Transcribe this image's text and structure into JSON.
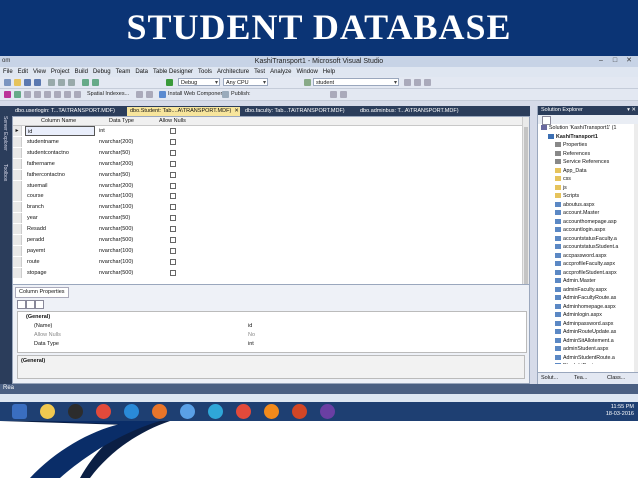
{
  "slide": {
    "title": "STUDENT DATABASE"
  },
  "window": {
    "title": "KashiTransport1 - Microsoft Visual Studio",
    "left_text": "om",
    "menu": [
      "File",
      "Edit",
      "View",
      "Project",
      "Build",
      "Debug",
      "Team",
      "Data",
      "Table Designer",
      "Tools",
      "Architecture",
      "Test",
      "Analyze",
      "Window",
      "Help"
    ]
  },
  "toolbar": {
    "config": "Debug",
    "platform": "Any CPU",
    "find": "student",
    "spatial": "Spatial Indexes...",
    "install": "Install Web Components",
    "publish": "Publish:"
  },
  "tabs": [
    {
      "label": "dbo.userlogin: T...TA\\TRANSPORT.MDF)",
      "active": false
    },
    {
      "label": "dbo.Student: Tab....A\\TRANSPORT.MDF)",
      "active": true,
      "close": "✕"
    },
    {
      "label": "dbo.faculty: Tab...TA\\TRANSPORT.MDF)",
      "active": false
    },
    {
      "label": "dbo.adminbus: T...A\\TRANSPORT.MDF)",
      "active": false
    }
  ],
  "left_tools": {
    "server": "Server Explorer",
    "toolbox": "Toolbox"
  },
  "table_designer": {
    "headers": {
      "column_name": "Column Name",
      "data_type": "Data Type",
      "allow_nulls": "Allow Nulls"
    },
    "rows": [
      {
        "name": "id",
        "type": "int"
      },
      {
        "name": "studentname",
        "type": "nvarchar(200)"
      },
      {
        "name": "studentcontactno",
        "type": "nvarchar(50)"
      },
      {
        "name": "fathername",
        "type": "nvarchar(200)"
      },
      {
        "name": "fathercontactno",
        "type": "nvarchar(50)"
      },
      {
        "name": "stuemail",
        "type": "nvarchar(200)"
      },
      {
        "name": "course",
        "type": "nvarchar(100)"
      },
      {
        "name": "branch",
        "type": "nvarchar(100)"
      },
      {
        "name": "year",
        "type": "nvarchar(50)"
      },
      {
        "name": "Resadd",
        "type": "nvarchar(500)"
      },
      {
        "name": "peradd",
        "type": "nvarchar(500)"
      },
      {
        "name": "payemt",
        "type": "nvarchar(100)"
      },
      {
        "name": "route",
        "type": "nvarchar(100)"
      },
      {
        "name": "stopage",
        "type": "nvarchar(500)"
      }
    ]
  },
  "column_properties": {
    "tab": "Column Properties",
    "rows": [
      {
        "key": "(General)",
        "value": "",
        "style": "bold"
      },
      {
        "key": "(Name)",
        "value": "id",
        "style": ""
      },
      {
        "key": "Allow Nulls",
        "value": "No",
        "style": "dim"
      },
      {
        "key": "Data Type",
        "value": "int",
        "style": ""
      }
    ],
    "description": "(General)"
  },
  "solution_explorer": {
    "title": "Solution Explorer",
    "pin": "▾ ✕",
    "items": [
      {
        "label": "Solution 'KashiTransport1' (1",
        "indent": 0,
        "icon": "#6a6aa0"
      },
      {
        "label": "KashiTransport1",
        "indent": 1,
        "icon": "#3b6fb3",
        "bold": true
      },
      {
        "label": "Properties",
        "indent": 2,
        "icon": "#888"
      },
      {
        "label": "References",
        "indent": 2,
        "icon": "#888"
      },
      {
        "label": "Service References",
        "indent": 2,
        "icon": "#888"
      },
      {
        "label": "App_Data",
        "indent": 2,
        "icon": "#e6c35c"
      },
      {
        "label": "css",
        "indent": 2,
        "icon": "#e6c35c"
      },
      {
        "label": "js",
        "indent": 2,
        "icon": "#e6c35c"
      },
      {
        "label": "Scripts",
        "indent": 2,
        "icon": "#e6c35c"
      },
      {
        "label": "aboutus.aspx",
        "indent": 2,
        "icon": "#5b88c4"
      },
      {
        "label": "account.Master",
        "indent": 2,
        "icon": "#5b88c4"
      },
      {
        "label": "accounthomepage.asp",
        "indent": 2,
        "icon": "#5b88c4"
      },
      {
        "label": "accountlogin.aspx",
        "indent": 2,
        "icon": "#5b88c4"
      },
      {
        "label": "accountstatusFaculty.a",
        "indent": 2,
        "icon": "#5b88c4"
      },
      {
        "label": "accountstatusStudent.a",
        "indent": 2,
        "icon": "#5b88c4"
      },
      {
        "label": "accpassword.aspx",
        "indent": 2,
        "icon": "#5b88c4"
      },
      {
        "label": "accprofileFaculty.aspx",
        "indent": 2,
        "icon": "#5b88c4"
      },
      {
        "label": "accprofileStudent.aspx",
        "indent": 2,
        "icon": "#5b88c4"
      },
      {
        "label": "Admin.Master",
        "indent": 2,
        "icon": "#5b88c4"
      },
      {
        "label": "adminFaculty.aspx",
        "indent": 2,
        "icon": "#5b88c4"
      },
      {
        "label": "AdminFacultyRoute.as",
        "indent": 2,
        "icon": "#5b88c4"
      },
      {
        "label": "Adminhomepage.aspx",
        "indent": 2,
        "icon": "#5b88c4"
      },
      {
        "label": "Adminlogin.aspx",
        "indent": 2,
        "icon": "#5b88c4"
      },
      {
        "label": "Adminpassword.aspx",
        "indent": 2,
        "icon": "#5b88c4"
      },
      {
        "label": "AdminRouteUpdate.as",
        "indent": 2,
        "icon": "#5b88c4"
      },
      {
        "label": "AdminSitAllotement.a",
        "indent": 2,
        "icon": "#5b88c4"
      },
      {
        "label": "adminStudent.aspx",
        "indent": 2,
        "icon": "#5b88c4"
      },
      {
        "label": "AdminStudentRoute.a",
        "indent": 2,
        "icon": "#5b88c4"
      },
      {
        "label": "BhadohiRoute.aspx",
        "indent": 2,
        "icon": "#5b88c4"
      }
    ],
    "tabs": [
      "Solut...",
      "Tea...",
      "Class..."
    ]
  },
  "status": {
    "text": "Rea"
  },
  "taskbar": {
    "time": "11:55 PM",
    "date": "18-03-2016",
    "apps": [
      {
        "name": "explorer-icon",
        "color": "#f0c850"
      },
      {
        "name": "media-player-icon",
        "color": "#2c2c2c"
      },
      {
        "name": "chrome-icon",
        "color": "#e24a3b"
      },
      {
        "name": "ie-icon",
        "color": "#2a8ad8"
      },
      {
        "name": "firefox-icon",
        "color": "#e8752a"
      },
      {
        "name": "windows-media-icon",
        "color": "#5aa0e6"
      },
      {
        "name": "camera-icon",
        "color": "#2fa7d8"
      },
      {
        "name": "chrome2-icon",
        "color": "#e24a3b"
      },
      {
        "name": "vlc-icon",
        "color": "#f28a1b"
      },
      {
        "name": "powerpoint-icon",
        "color": "#d24625"
      },
      {
        "name": "visual-studio-icon",
        "color": "#6a3fa3"
      }
    ]
  }
}
